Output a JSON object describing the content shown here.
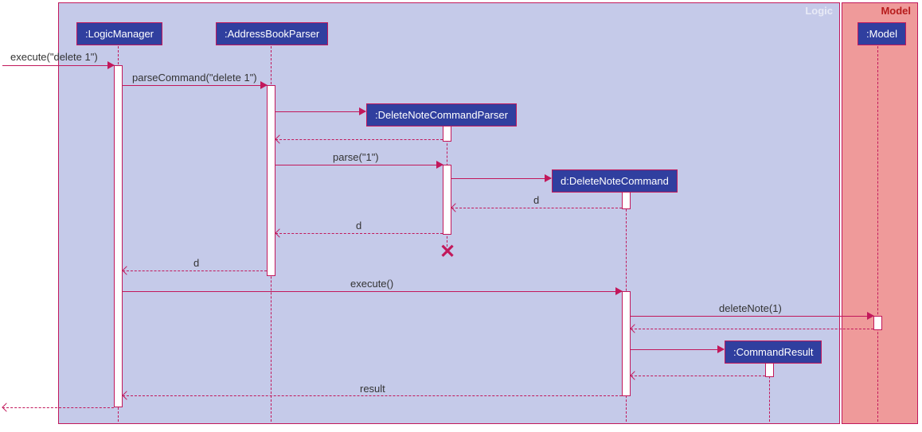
{
  "frames": {
    "logic": {
      "label": "Logic"
    },
    "model": {
      "label": "Model"
    }
  },
  "participants": {
    "logicManager": ":LogicManager",
    "addressBookParser": ":AddressBookParser",
    "deleteNoteCommandParser": ":DeleteNoteCommandParser",
    "deleteNoteCommand": "d:DeleteNoteCommand",
    "commandResult": ":CommandResult",
    "model": ":Model"
  },
  "messages": {
    "execute1": "execute(\"delete 1\")",
    "parseCommand": "parseCommand(\"delete 1\")",
    "parse1": "parse(\"1\")",
    "d1": "d",
    "d2": "d",
    "d3": "d",
    "execute2": "execute()",
    "deleteNote": "deleteNote(1)",
    "result": "result"
  },
  "chart_data": {
    "type": "sequence_diagram",
    "frames": [
      {
        "name": "Logic",
        "contains": [
          "LogicManager",
          "AddressBookParser",
          "DeleteNoteCommandParser",
          "DeleteNoteCommand",
          "CommandResult"
        ]
      },
      {
        "name": "Model",
        "contains": [
          "Model"
        ]
      }
    ],
    "participants": [
      {
        "id": "actor",
        "label": ""
      },
      {
        "id": "LogicManager",
        "label": ":LogicManager"
      },
      {
        "id": "AddressBookParser",
        "label": ":AddressBookParser"
      },
      {
        "id": "DeleteNoteCommandParser",
        "label": ":DeleteNoteCommandParser",
        "created_dynamically": true,
        "destroyed": true
      },
      {
        "id": "DeleteNoteCommand",
        "label": "d:DeleteNoteCommand",
        "created_dynamically": true
      },
      {
        "id": "CommandResult",
        "label": ":CommandResult",
        "created_dynamically": true
      },
      {
        "id": "Model",
        "label": ":Model"
      }
    ],
    "messages": [
      {
        "from": "actor",
        "to": "LogicManager",
        "label": "execute(\"delete 1\")",
        "type": "sync"
      },
      {
        "from": "LogicManager",
        "to": "AddressBookParser",
        "label": "parseCommand(\"delete 1\")",
        "type": "sync"
      },
      {
        "from": "AddressBookParser",
        "to": "DeleteNoteCommandParser",
        "label": "",
        "type": "create"
      },
      {
        "from": "DeleteNoteCommandParser",
        "to": "AddressBookParser",
        "label": "",
        "type": "return"
      },
      {
        "from": "AddressBookParser",
        "to": "DeleteNoteCommandParser",
        "label": "parse(\"1\")",
        "type": "sync"
      },
      {
        "from": "DeleteNoteCommandParser",
        "to": "DeleteNoteCommand",
        "label": "",
        "type": "create"
      },
      {
        "from": "DeleteNoteCommand",
        "to": "DeleteNoteCommandParser",
        "label": "d",
        "type": "return"
      },
      {
        "from": "DeleteNoteCommandParser",
        "to": "AddressBookParser",
        "label": "d",
        "type": "return"
      },
      {
        "from": "DeleteNoteCommandParser",
        "to": null,
        "label": "",
        "type": "destroy"
      },
      {
        "from": "AddressBookParser",
        "to": "LogicManager",
        "label": "d",
        "type": "return"
      },
      {
        "from": "LogicManager",
        "to": "DeleteNoteCommand",
        "label": "execute()",
        "type": "sync"
      },
      {
        "from": "DeleteNoteCommand",
        "to": "Model",
        "label": "deleteNote(1)",
        "type": "sync"
      },
      {
        "from": "Model",
        "to": "DeleteNoteCommand",
        "label": "",
        "type": "return"
      },
      {
        "from": "DeleteNoteCommand",
        "to": "CommandResult",
        "label": "",
        "type": "create"
      },
      {
        "from": "CommandResult",
        "to": "DeleteNoteCommand",
        "label": "",
        "type": "return"
      },
      {
        "from": "DeleteNoteCommand",
        "to": "LogicManager",
        "label": "result",
        "type": "return"
      },
      {
        "from": "LogicManager",
        "to": "actor",
        "label": "",
        "type": "return"
      }
    ]
  }
}
